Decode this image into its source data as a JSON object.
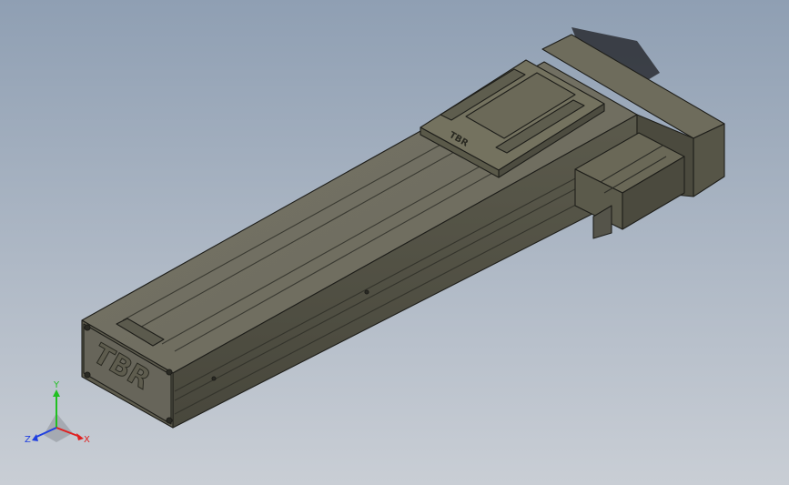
{
  "viewport": {
    "background_top": "#8f9fb3",
    "background_bottom": "#c9ced5"
  },
  "model": {
    "logo_text": "TBR",
    "carriage_logo_text": "TBR",
    "body_color": "#6c6a5a",
    "body_dark": "#4a4a3e",
    "body_light": "#8c8a78",
    "edge_color": "#1e1e1a"
  },
  "triad": {
    "x_label": "X",
    "y_label": "Y",
    "z_label": "Z",
    "x_color": "#e02020",
    "y_color": "#20c020",
    "z_color": "#2040e0"
  }
}
